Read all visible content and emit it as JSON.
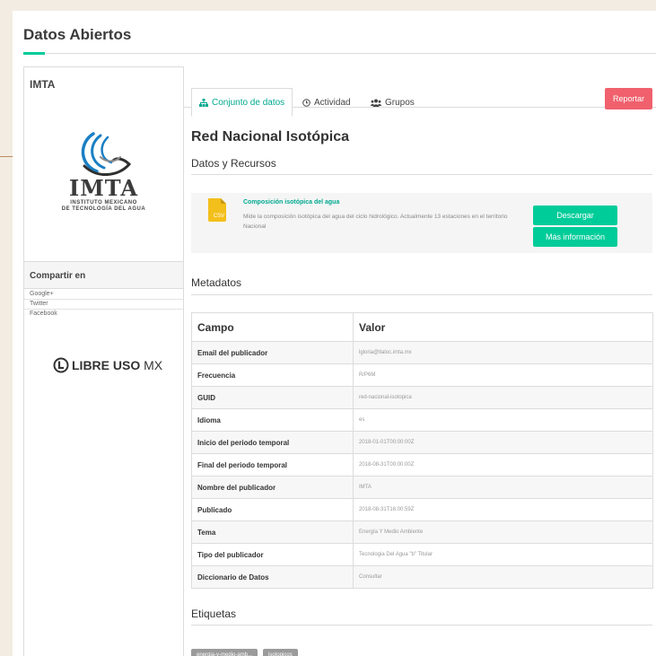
{
  "site": {
    "title": "Datos Abiertos"
  },
  "sidebar": {
    "org_name": "IMTA",
    "logo": {
      "word": "IMTA",
      "sub_line1": "INSTITUTO MEXICANO",
      "sub_line2": "DE TECNOLOGÍA DEL AGUA",
      "icon": "imta-wave-logo"
    },
    "share": {
      "label": "Compartir en",
      "items": [
        "Google+",
        "Twitter",
        "Facebook"
      ]
    },
    "license": {
      "bold": "LIBRE USO",
      "light": "MX",
      "icon": "libre-uso-logo"
    }
  },
  "tabs": [
    {
      "label": "Conjunto de datos",
      "icon": "sitemap-icon",
      "active": true
    },
    {
      "label": "Actividad",
      "icon": "clock-icon",
      "active": false
    },
    {
      "label": "Grupos",
      "icon": "users-icon",
      "active": false
    }
  ],
  "report_label": "Reportar",
  "dataset": {
    "title": "Red Nacional Isotópica",
    "resources_title": "Datos y Recursos",
    "resource": {
      "format": "CSV",
      "name": "Composición isotópica del agua",
      "description": "Mide la composición isotópica del agua del ciclo hidrológico. Actualmente 13 estaciones en el territorio Nacional",
      "download_label": "Descargar",
      "more_label": "Más información"
    },
    "metadata_title": "Metadatos",
    "metadata_headers": {
      "field": "Campo",
      "value": "Valor"
    },
    "metadata": [
      {
        "key": "Email del publicador",
        "value": "lgloria@tlaloc.imta.mx"
      },
      {
        "key": "Frecuencia",
        "value": "R/P6M"
      },
      {
        "key": "GUID",
        "value": "red-nacional-isotopica"
      },
      {
        "key": "Idioma",
        "value": "es"
      },
      {
        "key": "Inicio del periodo temporal",
        "value": "2018-01-01T00:00:00Z"
      },
      {
        "key": "Final del periodo temporal",
        "value": "2018-08-31T00:00:00Z"
      },
      {
        "key": "Nombre del publicador",
        "value": "IMTA"
      },
      {
        "key": "Publicado",
        "value": "2018-08-31T16:00:59Z"
      },
      {
        "key": "Tema",
        "value": "Energía Y Medio Ambiente"
      },
      {
        "key": "Tipo del publicador",
        "value": "Tecnologia Del Agua \"b\" Titular"
      },
      {
        "key": "Diccionario de Datos",
        "value": "Consultar"
      }
    ],
    "tags_title": "Etiquetas",
    "tags": [
      "energia-y-medio-amb...",
      "isotopicos"
    ]
  },
  "colors": {
    "accent": "#00cc99",
    "danger": "#f0616d",
    "link": "#00a98f",
    "page_bg": "#f3ece2"
  }
}
